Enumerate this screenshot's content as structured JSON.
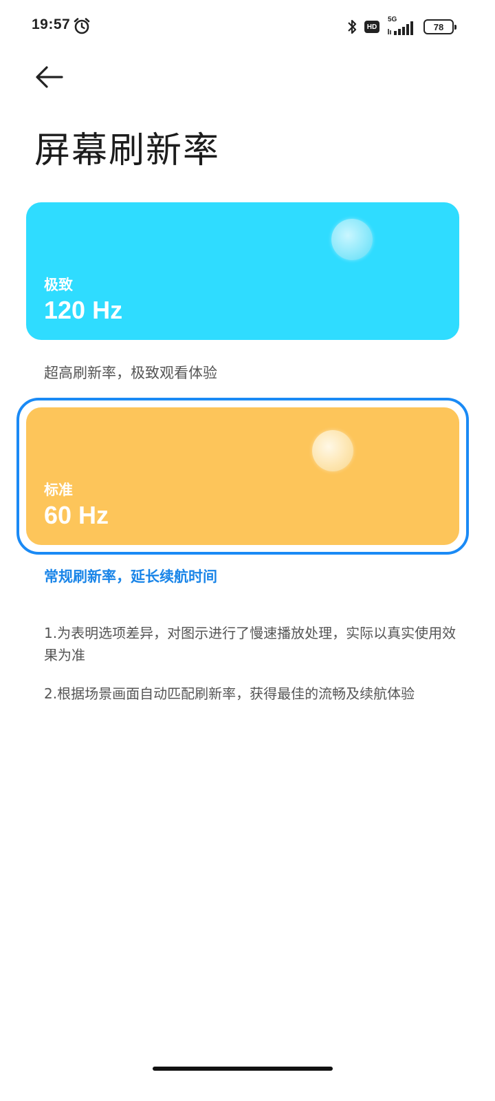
{
  "status_bar": {
    "time": "19:57",
    "network_type": "5G",
    "hd_label": "HD",
    "battery_level": "78"
  },
  "header": {
    "title": "屏幕刷新率"
  },
  "modes": [
    {
      "name": "极致",
      "frequency": "120 Hz",
      "description": "超高刷新率，极致观看体验",
      "color": "#2fdcff",
      "selected": false
    },
    {
      "name": "标准",
      "frequency": "60 Hz",
      "description": "常规刷新率，延长续航时间",
      "color": "#fdc55a",
      "selected": true
    }
  ],
  "notes": [
    "1.为表明选项差异，对图示进行了慢速播放处理，实际以真实使用效果为准",
    "2.根据场景画面自动匹配刷新率，获得最佳的流畅及续航体验"
  ],
  "colors": {
    "accent": "#1a8af5"
  }
}
